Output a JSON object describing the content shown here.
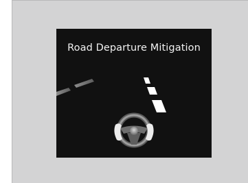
{
  "display": {
    "title": "Road Departure Mitigation"
  },
  "icons": {
    "left_lane_marking": "left-lane-marking-dashed",
    "right_lane_marking": "right-lane-marking-dashed",
    "steering_wheel": "steering-wheel-with-hands-icon"
  },
  "colors": {
    "background": "#d3d3d4",
    "screen": "#111111",
    "text": "#f2f2f2",
    "left_marking": "#9a9a9a",
    "right_marking": "#ffffff"
  }
}
